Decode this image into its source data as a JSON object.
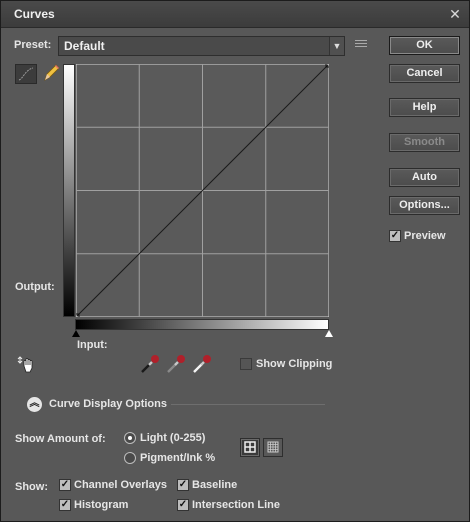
{
  "window": {
    "title": "Curves",
    "close_glyph": "✕"
  },
  "preset": {
    "label": "Preset:",
    "value": "Default"
  },
  "buttons": {
    "ok": "OK",
    "cancel": "Cancel",
    "help": "Help",
    "smooth": "Smooth",
    "auto": "Auto",
    "options": "Options..."
  },
  "preview": {
    "label": "Preview",
    "checked": true
  },
  "graph": {
    "output_label": "Output:",
    "input_label": "Input:",
    "grid_divisions": 4,
    "curve_points": [
      [
        0,
        0
      ],
      [
        255,
        255
      ]
    ],
    "line_color": "#1a1a1a",
    "grid_color": "#a0a0a0"
  },
  "show_clipping": {
    "label": "Show Clipping",
    "checked": false
  },
  "curve_display": {
    "label": "Curve Display Options"
  },
  "show_amount": {
    "label": "Show Amount of:",
    "options": [
      {
        "label": "Light  (0-255)",
        "selected": true
      },
      {
        "label": "Pigment/Ink %",
        "selected": false
      }
    ]
  },
  "show": {
    "label": "Show:",
    "items": [
      {
        "label": "Channel Overlays",
        "checked": true
      },
      {
        "label": "Baseline",
        "checked": true
      },
      {
        "label": "Histogram",
        "checked": true
      },
      {
        "label": "Intersection Line",
        "checked": true
      }
    ]
  },
  "icons": [
    "curve-tool-icon",
    "pencil-icon",
    "hand-adjust-icon",
    "black-eyedropper-icon",
    "gray-eyedropper-icon",
    "white-eyedropper-icon",
    "preset-menu-icon",
    "simple-grid-icon",
    "detailed-grid-icon",
    "collapse-icon",
    "close-icon"
  ]
}
